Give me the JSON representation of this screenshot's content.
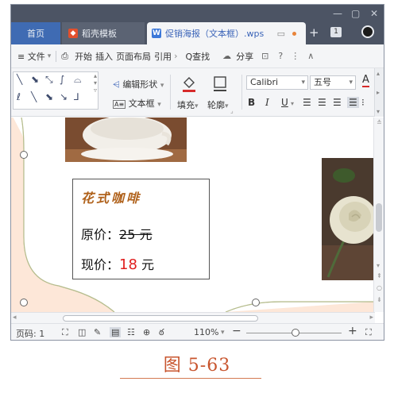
{
  "titlebar": {
    "tabs": [
      {
        "label": "首页"
      },
      {
        "label": "稻壳模板"
      },
      {
        "label": "促销海报（文本框）.wps"
      }
    ],
    "right_buttons": [
      "+",
      "1"
    ]
  },
  "menubar": {
    "menu_label": "≡ 文件",
    "items": [
      "开始",
      "插入",
      "页面布局",
      "引用"
    ],
    "search_label": "Q查找",
    "share_label": "分享"
  },
  "ribbon": {
    "edit_shape_label": "编辑形状",
    "textbox_label": "文本框",
    "fill_label": "填充",
    "outline_label": "轮廓",
    "font_name": "Calibri",
    "font_size": "五号",
    "format_buttons": [
      "B",
      "I",
      "U"
    ]
  },
  "document": {
    "card": {
      "title": "花式咖啡",
      "original_label": "原价：",
      "original_value": "25 元",
      "now_label": "现价：",
      "now_value": "18",
      "now_unit": "元"
    }
  },
  "statusbar": {
    "page_label": "页码: 1",
    "zoom_label": "110%",
    "zoom_level": 0.52
  },
  "caption": {
    "text": "图 5-63"
  },
  "colors": {
    "titlebar_bg": "#4c5464",
    "home_tab": "#3f6bb3",
    "canvas_bg": "#fde7d8",
    "card_title": "#b0621c",
    "price_now": "#e01e1e",
    "caption": "#c8552e"
  }
}
